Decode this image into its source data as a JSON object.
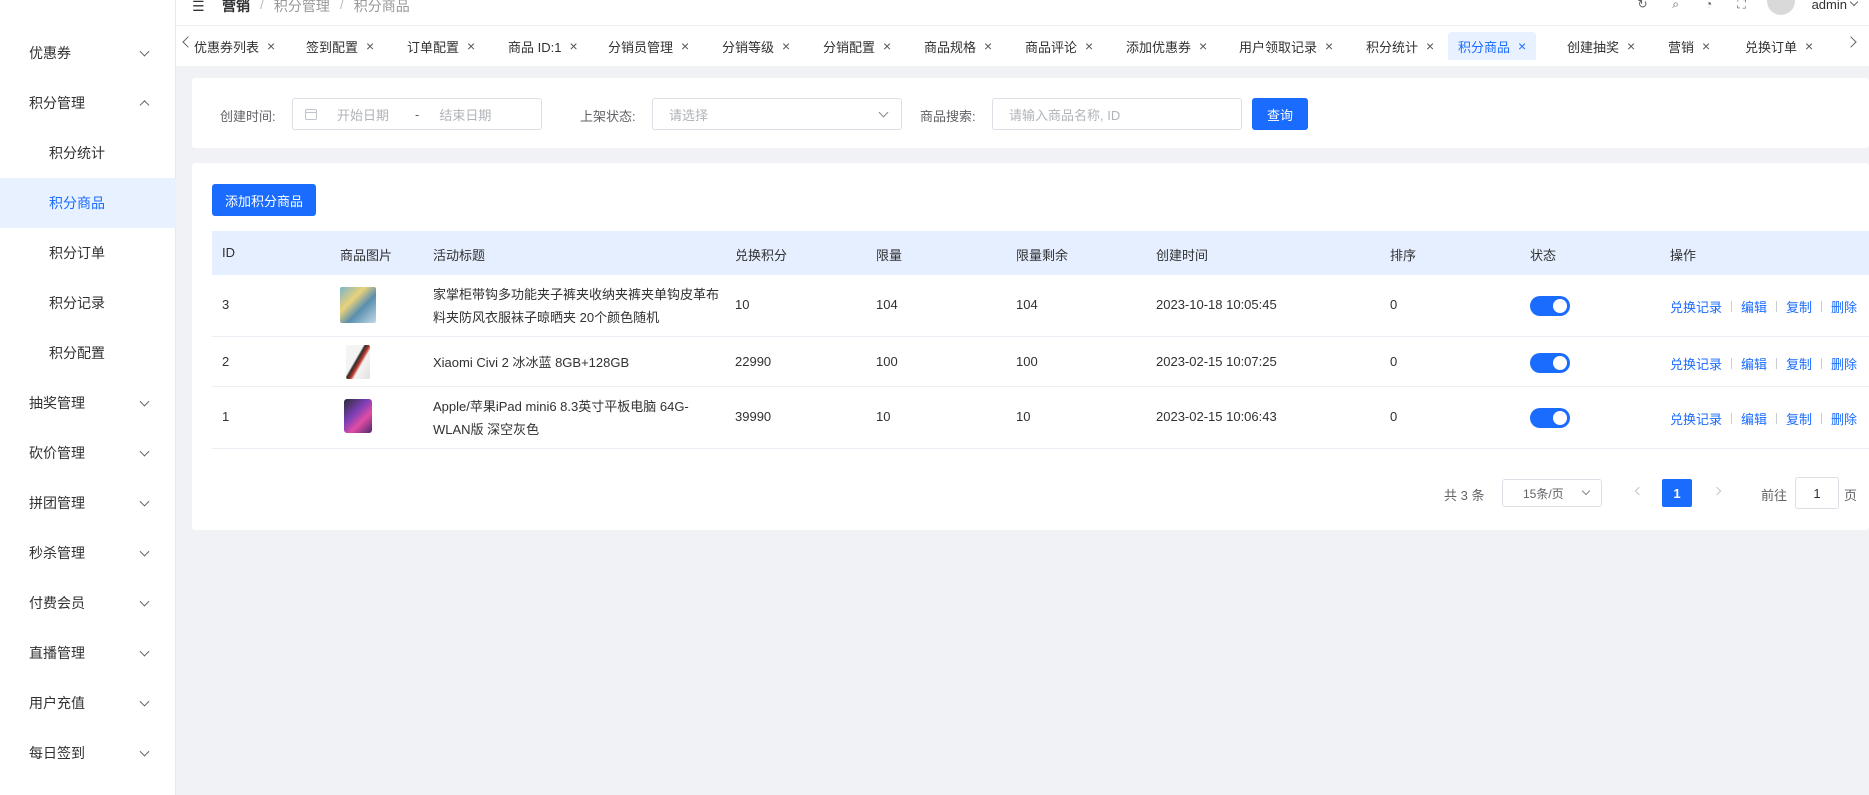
{
  "sidebar": {
    "items": [
      {
        "label": "优惠券",
        "expanded": false
      },
      {
        "label": "积分管理",
        "expanded": true
      },
      {
        "label": "积分统计"
      },
      {
        "label": "积分商品",
        "active": true
      },
      {
        "label": "积分订单"
      },
      {
        "label": "积分记录"
      },
      {
        "label": "积分配置"
      },
      {
        "label": "抽奖管理",
        "expanded": false
      },
      {
        "label": "砍价管理",
        "expanded": false
      },
      {
        "label": "拼团管理",
        "expanded": false
      },
      {
        "label": "秒杀管理",
        "expanded": false
      },
      {
        "label": "付费会员",
        "expanded": false
      },
      {
        "label": "直播管理",
        "expanded": false
      },
      {
        "label": "用户充值",
        "expanded": false
      },
      {
        "label": "每日签到",
        "expanded": false
      }
    ]
  },
  "header": {
    "breadcrumb": [
      "营销",
      "积分管理",
      "积分商品"
    ],
    "user": "admin"
  },
  "tabs": [
    {
      "label": "优惠券列表"
    },
    {
      "label": "签到配置"
    },
    {
      "label": "订单配置"
    },
    {
      "label": "商品 ID:1"
    },
    {
      "label": "分销员管理"
    },
    {
      "label": "分销等级"
    },
    {
      "label": "分销配置"
    },
    {
      "label": "商品规格"
    },
    {
      "label": "商品评论"
    },
    {
      "label": "添加优惠券"
    },
    {
      "label": "用户领取记录"
    },
    {
      "label": "积分统计"
    },
    {
      "label": "积分商品",
      "active": true
    },
    {
      "label": "创建抽奖"
    },
    {
      "label": "营销"
    },
    {
      "label": "兑换订单"
    }
  ],
  "filters": {
    "created_label": "创建时间:",
    "start_placeholder": "开始日期",
    "range_sep": "-",
    "end_placeholder": "结束日期",
    "status_label": "上架状态:",
    "status_placeholder": "请选择",
    "search_label": "商品搜索:",
    "search_placeholder": "请输入商品名称, ID",
    "query_button": "查询"
  },
  "toolbar": {
    "add_button": "添加积分商品"
  },
  "table": {
    "columns": [
      "ID",
      "商品图片",
      "活动标题",
      "兑换积分",
      "限量",
      "限量剩余",
      "创建时间",
      "排序",
      "状态",
      "操作"
    ],
    "rows": [
      {
        "id": "3",
        "title": "家掌柜带钩多功能夹子裤夹收纳夹裤夹单钩皮革布料夹防风衣服袜子晾晒夹 20个颜色随机",
        "points": "10",
        "limit": "104",
        "remaining": "104",
        "created": "2023-10-18 10:05:45",
        "sort": "0",
        "enabled": true
      },
      {
        "id": "2",
        "title": "Xiaomi Civi 2 冰冰蓝 8GB+128GB",
        "points": "22990",
        "limit": "100",
        "remaining": "100",
        "created": "2023-02-15 10:07:25",
        "sort": "0",
        "enabled": true
      },
      {
        "id": "1",
        "title": "Apple/苹果iPad mini6 8.3英寸平板电脑 64G-WLAN版 深空灰色",
        "points": "39990",
        "limit": "10",
        "remaining": "10",
        "created": "2023-02-15 10:06:43",
        "sort": "0",
        "enabled": true
      }
    ],
    "actions": [
      "兑换记录",
      "编辑",
      "复制",
      "删除"
    ]
  },
  "pagination": {
    "total": "共 3 条",
    "page_size": "15条/页",
    "current": "1",
    "goto_prefix": "前往",
    "goto_value": "1",
    "goto_suffix": "页"
  },
  "colors": {
    "primary": "#1a6cff",
    "active_bg": "#e8f1ff",
    "header_row_bg": "#e6efff"
  }
}
